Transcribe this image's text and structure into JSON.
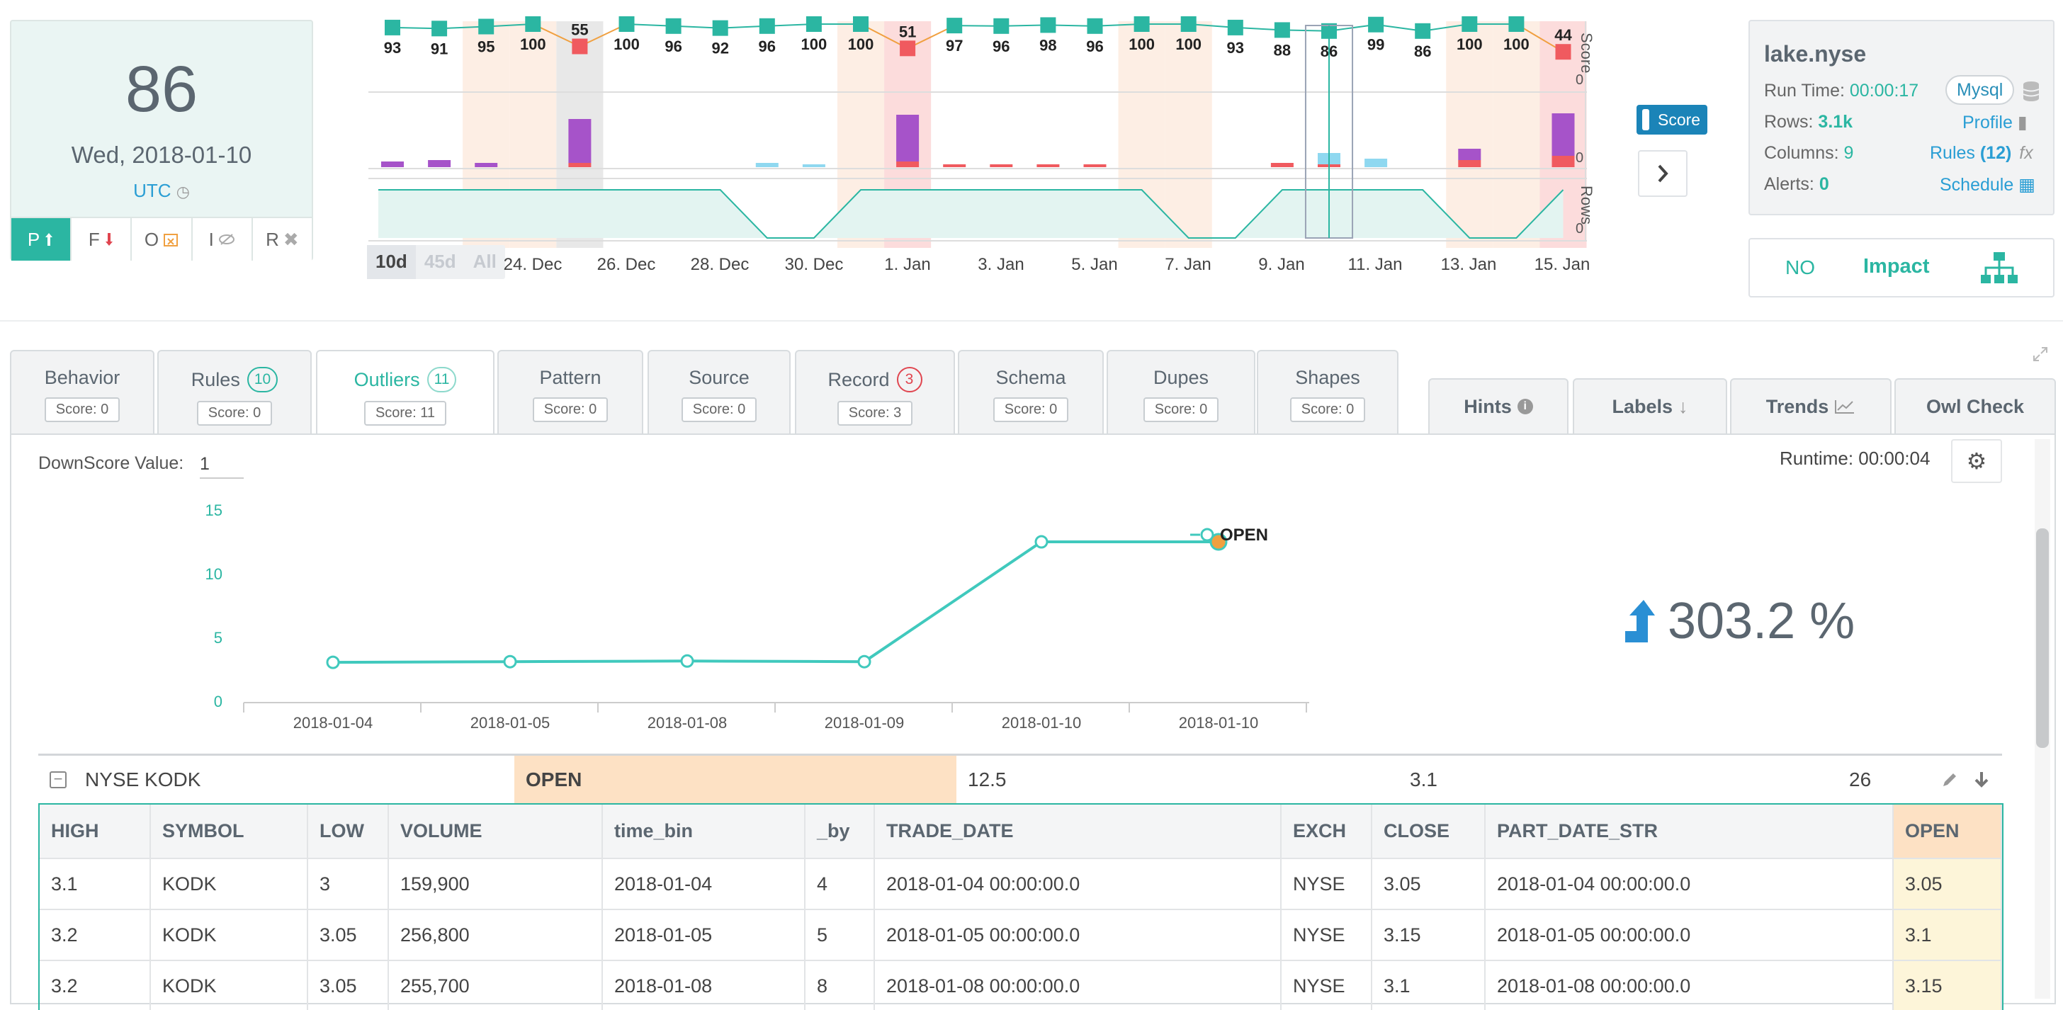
{
  "score_card": {
    "score": "86",
    "date": "Wed, 2018-01-10",
    "timezone": "UTC",
    "filters": [
      {
        "label": "P",
        "icon": "arrow-up-icon",
        "active": true
      },
      {
        "label": "F",
        "icon": "arrow-down-red-icon",
        "active": false
      },
      {
        "label": "O",
        "icon": "calendar-x-icon",
        "active": false
      },
      {
        "label": "I",
        "icon": "eye-slash-icon",
        "active": false
      },
      {
        "label": "R",
        "icon": "close-icon",
        "active": false
      }
    ]
  },
  "timeline": {
    "score_axis_label": "Score",
    "rows_axis_label": "Rows",
    "score_axis_zero": "0",
    "mid_axis_zero": "0",
    "rows_axis_zero": "0",
    "range_buttons": [
      "10d",
      "45d",
      "All"
    ],
    "date_labels": [
      "24. Dec",
      "26. Dec",
      "28. Dec",
      "30. Dec",
      "1. Jan",
      "3. Jan",
      "5. Jan",
      "7. Jan",
      "9. Jan",
      "11. Jan",
      "13. Jan",
      "15. Jan"
    ],
    "scores": [
      93,
      91,
      95,
      100,
      55,
      100,
      96,
      92,
      96,
      100,
      100,
      51,
      97,
      96,
      98,
      96,
      100,
      100,
      93,
      88,
      86,
      99,
      86,
      100,
      100,
      44
    ],
    "toggle_label": "Score"
  },
  "info_card": {
    "title": "lake.nyse",
    "run_time_label": "Run Time:",
    "run_time": "00:00:17",
    "db_label": "Mysql",
    "rows_label": "Rows:",
    "rows": "3.1k",
    "profile_label": "Profile",
    "columns_label": "Columns:",
    "columns": "9",
    "rules_label": "Rules",
    "rules_count": "(12)",
    "fx": "fx",
    "alerts_label": "Alerts:",
    "alerts": "0",
    "schedule_label": "Schedule"
  },
  "impact": {
    "no": "NO",
    "label": "Impact"
  },
  "tabs": [
    {
      "title": "Behavior",
      "badge": "",
      "score": "Score: 0",
      "active": false
    },
    {
      "title": "Rules",
      "badge": "10",
      "score": "Score: 0",
      "active": false
    },
    {
      "title": "Outliers",
      "badge": "11",
      "score": "Score: 11",
      "active": true
    },
    {
      "title": "Pattern",
      "badge": "",
      "score": "Score: 0",
      "active": false
    },
    {
      "title": "Source",
      "badge": "",
      "score": "Score: 0",
      "active": false
    },
    {
      "title": "Record",
      "badge": "3",
      "score": "Score: 3",
      "active": false
    },
    {
      "title": "Schema",
      "badge": "",
      "score": "Score: 0",
      "active": false
    },
    {
      "title": "Dupes",
      "badge": "",
      "score": "Score: 0",
      "active": false
    },
    {
      "title": "Shapes",
      "badge": "",
      "score": "Score: 0",
      "active": false
    }
  ],
  "right_tabs": [
    "Hints",
    "Labels",
    "Trends",
    "Owl Check"
  ],
  "panel": {
    "downscore_label": "DownScore Value:",
    "downscore_value": "1",
    "runtime": "Runtime: 00:00:04",
    "change_pct": "303.2 %"
  },
  "chart_data": {
    "type": "line",
    "categories": [
      "2018-01-04",
      "2018-01-05",
      "2018-01-08",
      "2018-01-09",
      "2018-01-10",
      "2018-01-10"
    ],
    "series": [
      {
        "name": "OPEN",
        "values": [
          3.05,
          3.1,
          3.15,
          3.1,
          12.5,
          12.5
        ]
      }
    ],
    "highlight_value": 12.5,
    "yticks": [
      0,
      5,
      10,
      15
    ],
    "ylim": [
      0,
      15
    ],
    "xlabel": "",
    "ylabel": "",
    "title": ""
  },
  "group_row": {
    "name": "NYSE KODK",
    "column": "OPEN",
    "value": "12.5",
    "baseline": "3.1",
    "count": "26"
  },
  "table": {
    "columns": [
      "HIGH",
      "SYMBOL",
      "LOW",
      "VOLUME",
      "time_bin",
      "_by",
      "TRADE_DATE",
      "EXCH",
      "CLOSE",
      "PART_DATE_STR",
      "OPEN"
    ],
    "rows": [
      [
        "3.1",
        "KODK",
        "3",
        "159,900",
        "2018-01-04",
        "4",
        "2018-01-04 00:00:00.0",
        "NYSE",
        "3.05",
        "2018-01-04 00:00:00.0",
        "3.05"
      ],
      [
        "3.2",
        "KODK",
        "3.05",
        "256,800",
        "2018-01-05",
        "5",
        "2018-01-05 00:00:00.0",
        "NYSE",
        "3.15",
        "2018-01-05 00:00:00.0",
        "3.1"
      ],
      [
        "3.2",
        "KODK",
        "3.05",
        "255,700",
        "2018-01-08",
        "8",
        "2018-01-08 00:00:00.0",
        "NYSE",
        "3.1",
        "2018-01-08 00:00:00.0",
        "3.15"
      ]
    ]
  },
  "colors": {
    "teal": "#2bb6a2",
    "blue": "#2a9ed4",
    "orange": "#f0a040",
    "red": "#f05a5f",
    "purple": "#a653c9"
  }
}
